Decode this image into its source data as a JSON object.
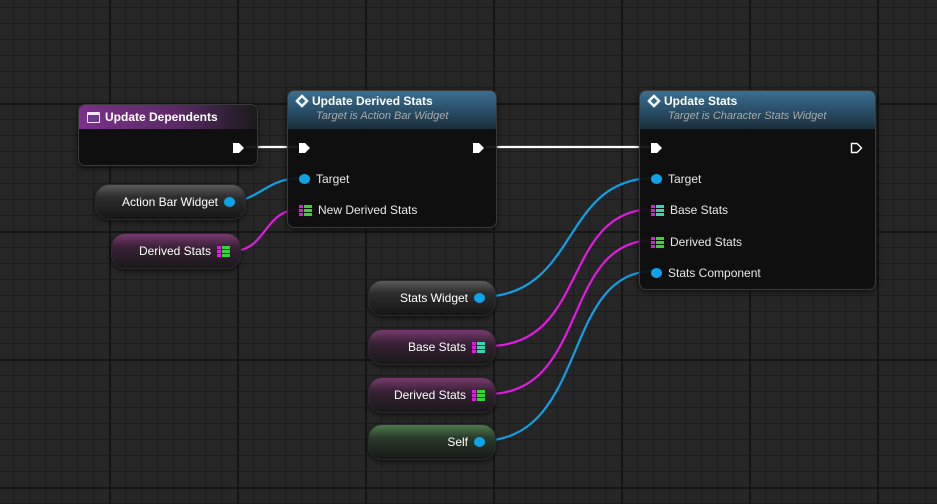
{
  "nodes": {
    "update_dependents": {
      "title": "Update Dependents"
    },
    "update_derived_stats": {
      "title": "Update Derived Stats",
      "subtitle": "Target is Action Bar Widget",
      "pins": {
        "target": "Target",
        "new_derived_stats": "New Derived Stats"
      }
    },
    "update_stats": {
      "title": "Update Stats",
      "subtitle": "Target is Character Stats Widget",
      "pins": {
        "target": "Target",
        "base_stats": "Base Stats",
        "derived_stats": "Derived Stats",
        "stats_component": "Stats Component"
      }
    }
  },
  "variables": {
    "action_bar_widget": "Action Bar Widget",
    "derived_stats_1": "Derived Stats",
    "stats_widget": "Stats Widget",
    "base_stats": "Base Stats",
    "derived_stats_2": "Derived Stats",
    "self": "Self"
  },
  "colors": {
    "object_pin": "#0ea2e8",
    "struct_pink": "#e21ae2",
    "struct_green": "#33d633",
    "struct_teal": "#35d6b0",
    "exec_wire": "#ffffff",
    "event_header": "#6a2f78",
    "function_header": "#2e5f7f"
  },
  "icons": {
    "event": "event-node-icon",
    "function": "function-node-icon",
    "exec": "exec-pin-icon",
    "object": "object-pin-icon",
    "struct": "struct-pin-icon"
  }
}
